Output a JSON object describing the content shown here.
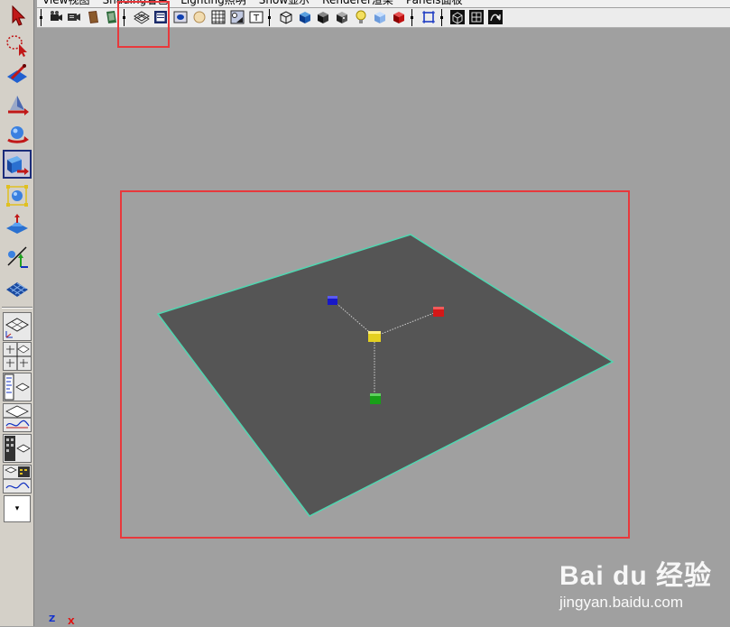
{
  "menubar": {
    "items": [
      "View视图",
      "Shading着色",
      "Lighting照明",
      "Show显示",
      "Renderer渲染",
      "Panels面板"
    ]
  },
  "toolbox": {
    "tools": [
      {
        "name": "select-tool-icon"
      },
      {
        "name": "lasso-tool-icon"
      },
      {
        "name": "paint-select-tool-icon"
      },
      {
        "name": "move-tool-icon"
      },
      {
        "name": "rotate-tool-icon"
      },
      {
        "name": "scale-tool-icon",
        "active": true
      },
      {
        "name": "universal-manipulator-icon"
      },
      {
        "name": "soft-modification-icon"
      },
      {
        "name": "show-manipulator-icon"
      },
      {
        "name": "last-tool-used-icon"
      }
    ],
    "layouts": [
      "single-perspective-layout-icon",
      "four-view-layout-icon",
      "outliner-perspective-layout-icon",
      "graph-editor-perspective-layout-icon",
      "hypershade-perspective-layout-icon",
      "persp-graph-hypershade-layout-icon"
    ],
    "menu_arrow": "▾"
  },
  "viewport": {
    "axis_labels": {
      "z": "Z",
      "x": "X"
    },
    "colors": {
      "background": "#a0a0a0",
      "plane_fill": "#555555",
      "plane_edge": "#4fd6b0",
      "highlight": "#e8393c",
      "handle_x": "#d41818",
      "handle_y": "#18a018",
      "handle_z": "#1818c8",
      "handle_center": "#e4d020"
    }
  },
  "watermark": {
    "brand": "Bai du 经验",
    "url": "jingyan.baidu.com"
  }
}
